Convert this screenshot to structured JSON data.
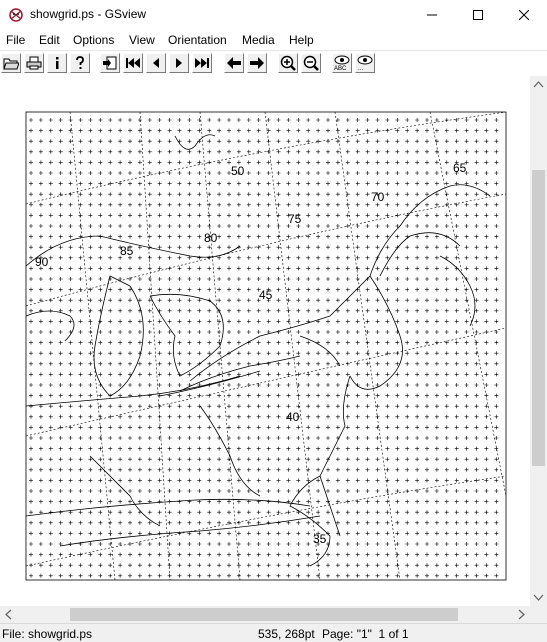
{
  "window": {
    "title": "showgrid.ps - GSview",
    "app_icon": "gsview-ghost-icon",
    "controls": [
      "minimize-icon",
      "maximize-icon",
      "close-icon"
    ]
  },
  "menu": [
    "File",
    "Edit",
    "Options",
    "View",
    "Orientation",
    "Media",
    "Help"
  ],
  "toolbar": {
    "buttons": [
      "open-icon",
      "print-icon",
      "info-icon",
      "help-icon",
      "goto-page-icon",
      "first-page-icon",
      "prev-page-icon",
      "next-page-icon",
      "last-page-icon",
      "back-icon",
      "forward-icon",
      "zoom-in-icon",
      "zoom-out-icon",
      "view-text-icon",
      "view-clip-icon"
    ]
  },
  "map": {
    "latitude_labels": [
      "50",
      "45",
      "40",
      "35"
    ],
    "longitude_labels": [
      "90",
      "85",
      "80",
      "75",
      "70",
      "65"
    ]
  },
  "status": {
    "file": "File: showgrid.ps",
    "coords": "535, 268pt",
    "page": "Page: \"1\"  1 of 1"
  }
}
